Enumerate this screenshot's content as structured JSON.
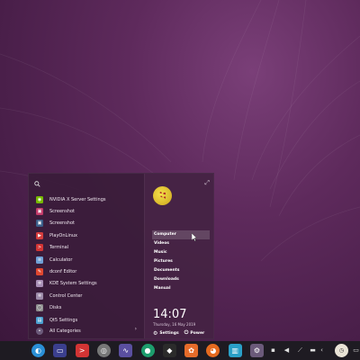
{
  "menu": {
    "search": {
      "placeholder": "",
      "icon": "search-icon"
    },
    "apps": [
      {
        "label": "NVIDIA X Server Settings",
        "icon": "nvidia-icon",
        "color": "#76b900"
      },
      {
        "label": "Screenshot",
        "icon": "screenshot-icon",
        "color": "#c23b6a"
      },
      {
        "label": "Screenshot",
        "icon": "screenshot-icon",
        "color": "#3b5f8a"
      },
      {
        "label": "PlayOnLinux",
        "icon": "playonlinux-icon",
        "color": "#d43d3d"
      },
      {
        "label": "Terminal",
        "icon": "terminal-icon",
        "color": "#d23434"
      },
      {
        "label": "Calculator",
        "icon": "calculator-icon",
        "color": "#6fa0d6"
      },
      {
        "label": "dconf Editor",
        "icon": "dconf-icon",
        "color": "#e0472f"
      },
      {
        "label": "KDE System Settings",
        "icon": "kde-settings-icon",
        "color": "#a98fb5"
      },
      {
        "label": "Control Center",
        "icon": "control-center-icon",
        "color": "#9c8aa8"
      },
      {
        "label": "Disks",
        "icon": "disks-icon",
        "color": "#8c8c8c"
      },
      {
        "label": "Qt5 Settings",
        "icon": "qt-settings-icon",
        "color": "#4aa0d0"
      }
    ],
    "all_categories": "All Categories",
    "places": [
      "Computer",
      "Videos",
      "Music",
      "Pictures",
      "Documents",
      "Downloads",
      "Manual"
    ],
    "clock": "14:07",
    "date": "Thursday, 16 May 2019",
    "settings_label": "Settings",
    "power_label": "Power"
  },
  "taskbar": {
    "apps": [
      {
        "icon": "launcher-icon",
        "color": "#2a8fd6"
      },
      {
        "icon": "monitor-icon",
        "color": "#3b3f8e"
      },
      {
        "icon": "terminal-icon",
        "color": "#d23434"
      },
      {
        "icon": "disk-icon",
        "color": "#777777"
      },
      {
        "icon": "system-monitor-icon",
        "color": "#5a4fa0"
      },
      {
        "icon": "settings-icon",
        "color": "#1d9e6d"
      },
      {
        "icon": "dark-app-icon",
        "color": "#2b2b2b"
      },
      {
        "icon": "photos-icon",
        "color": "#e56b2a"
      },
      {
        "icon": "firefox-icon",
        "color": "#e66a1f"
      },
      {
        "icon": "waveform-icon",
        "color": "#2aa0c8"
      },
      {
        "icon": "gear-icon",
        "color": "#6b5a7a"
      }
    ]
  }
}
